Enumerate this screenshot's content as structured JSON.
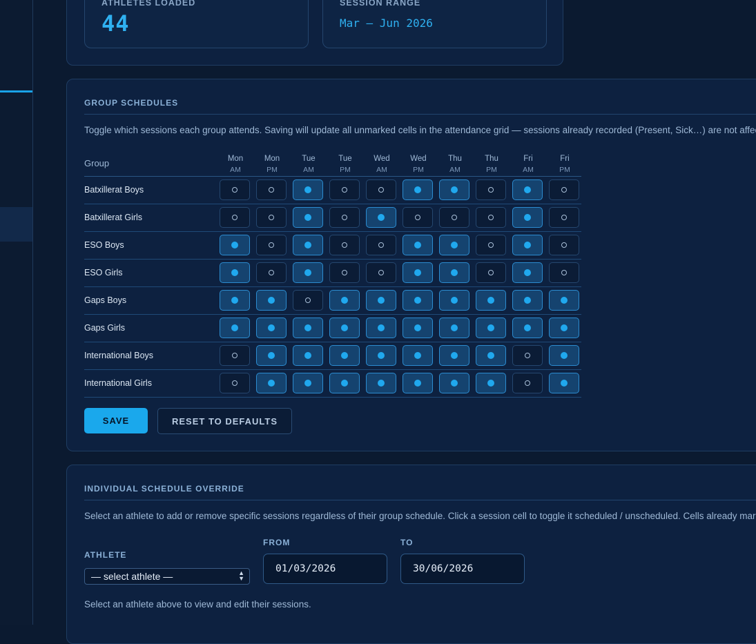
{
  "stats": {
    "athletes_label": "ATHLETES LOADED",
    "athletes_value": "44",
    "range_label": "SESSION RANGE",
    "range_value": "Mar – Jun 2026"
  },
  "group_schedules": {
    "title": "GROUP SCHEDULES",
    "description": "Toggle which sessions each group attends. Saving will update all unmarked cells in the attendance grid — sessions already recorded (Present, Sick…) are not affected.",
    "group_header": "Group",
    "columns": [
      {
        "day": "Mon",
        "part": "AM"
      },
      {
        "day": "Mon",
        "part": "PM"
      },
      {
        "day": "Tue",
        "part": "AM"
      },
      {
        "day": "Tue",
        "part": "PM"
      },
      {
        "day": "Wed",
        "part": "AM"
      },
      {
        "day": "Wed",
        "part": "PM"
      },
      {
        "day": "Thu",
        "part": "AM"
      },
      {
        "day": "Thu",
        "part": "PM"
      },
      {
        "day": "Fri",
        "part": "AM"
      },
      {
        "day": "Fri",
        "part": "PM"
      }
    ],
    "rows": [
      {
        "name": "Batxillerat Boys",
        "sessions": [
          0,
          0,
          1,
          0,
          0,
          1,
          1,
          0,
          1,
          0
        ]
      },
      {
        "name": "Batxillerat Girls",
        "sessions": [
          0,
          0,
          1,
          0,
          1,
          0,
          0,
          0,
          1,
          0
        ]
      },
      {
        "name": "ESO Boys",
        "sessions": [
          1,
          0,
          1,
          0,
          0,
          1,
          1,
          0,
          1,
          0
        ]
      },
      {
        "name": "ESO Girls",
        "sessions": [
          1,
          0,
          1,
          0,
          0,
          1,
          1,
          0,
          1,
          0
        ]
      },
      {
        "name": "Gaps Boys",
        "sessions": [
          1,
          1,
          0,
          1,
          1,
          1,
          1,
          1,
          1,
          1
        ]
      },
      {
        "name": "Gaps Girls",
        "sessions": [
          1,
          1,
          1,
          1,
          1,
          1,
          1,
          1,
          1,
          1
        ]
      },
      {
        "name": "International Boys",
        "sessions": [
          0,
          1,
          1,
          1,
          1,
          1,
          1,
          1,
          0,
          1
        ]
      },
      {
        "name": "International Girls",
        "sessions": [
          0,
          1,
          1,
          1,
          1,
          1,
          1,
          1,
          0,
          1
        ]
      }
    ],
    "save_label": "SAVE",
    "reset_label": "RESET TO DEFAULTS"
  },
  "override": {
    "title": "INDIVIDUAL SCHEDULE OVERRIDE",
    "description": "Select an athlete to add or remove specific sessions regardless of their group schedule. Click a session cell to toggle it scheduled / unscheduled. Cells already marked w",
    "athlete_label": "ATHLETE",
    "athlete_select_value": "— select athlete —",
    "from_label": "FROM",
    "from_value": "01/03/2026",
    "to_label": "TO",
    "to_value": "30/06/2026",
    "hint": "Select an athlete above to view and edit their sessions."
  },
  "colors": {
    "accent": "#1aa8ec",
    "background": "#0b1a30",
    "card": "#0d2140"
  }
}
